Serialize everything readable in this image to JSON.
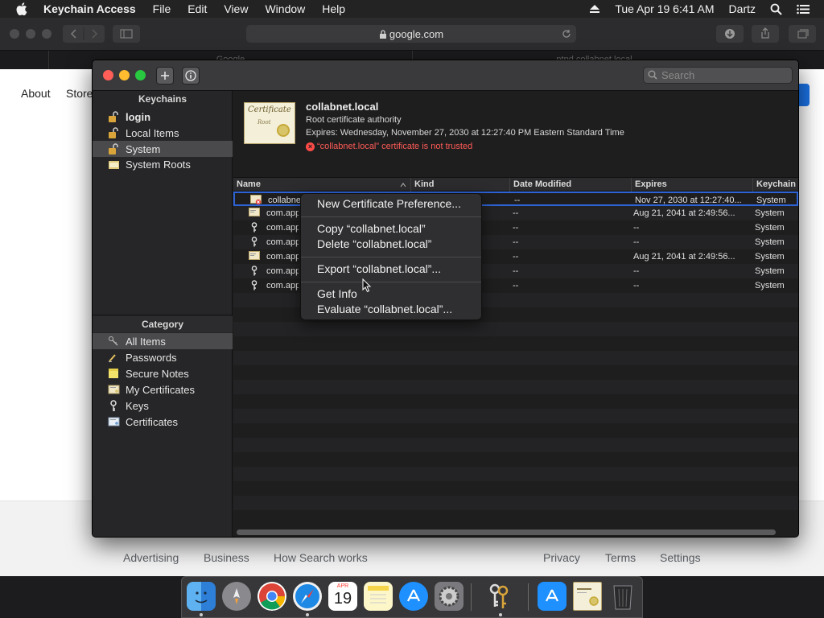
{
  "menubar": {
    "app_name": "Keychain Access",
    "menus": [
      "File",
      "Edit",
      "View",
      "Window",
      "Help"
    ],
    "datetime": "Tue Apr 19  6:41 AM",
    "user": "Dartz"
  },
  "safari": {
    "url": "google.com",
    "tabs": [
      "Google",
      "ntpd.collabnet.local"
    ]
  },
  "webpage": {
    "top_links": [
      "About",
      "Store"
    ],
    "footer_links_left": [
      "Advertising",
      "Business",
      "How Search works"
    ],
    "footer_links_right": [
      "Privacy",
      "Terms",
      "Settings"
    ]
  },
  "keychain_window": {
    "search_placeholder": "Search",
    "sidebar": {
      "keychains_header": "Keychains",
      "keychains": [
        {
          "label": "login",
          "icon": "lock-open-icon"
        },
        {
          "label": "Local Items",
          "icon": "lock-icon"
        },
        {
          "label": "System",
          "icon": "lock-icon",
          "selected": true
        },
        {
          "label": "System Roots",
          "icon": "folder-icon"
        }
      ],
      "category_header": "Category",
      "categories": [
        {
          "label": "All Items",
          "icon": "all-items-icon",
          "selected": true
        },
        {
          "label": "Passwords",
          "icon": "pencil-icon"
        },
        {
          "label": "Secure Notes",
          "icon": "note-icon"
        },
        {
          "label": "My Certificates",
          "icon": "my-certificate-icon"
        },
        {
          "label": "Keys",
          "icon": "key-icon"
        },
        {
          "label": "Certificates",
          "icon": "certificate-icon"
        }
      ]
    },
    "cert_info": {
      "icon_text": "Certificate",
      "icon_subtext": "Root",
      "name": "collabnet.local",
      "type": "Root certificate authority",
      "expires": "Expires: Wednesday, November 27, 2030 at 12:27:40 PM Eastern Standard Time",
      "warning": "“collabnet.local” certificate is not trusted"
    },
    "table": {
      "columns": [
        "Name",
        "Kind",
        "Date Modified",
        "Expires",
        "Keychain"
      ],
      "rows": [
        {
          "name": "collabnet.local",
          "icon": "certificate-untrusted-icon",
          "kind": "",
          "modified": "--",
          "expires": "Nov 27, 2030 at 12:27:40...",
          "keychain": "System",
          "selected": true
        },
        {
          "name": "com.apple.",
          "icon": "certificate-icon",
          "kind": "",
          "modified": "--",
          "expires": "Aug 21, 2041 at 2:49:56...",
          "keychain": "System"
        },
        {
          "name": "com.apple.",
          "icon": "key-icon",
          "kind": "",
          "modified": "--",
          "expires": "--",
          "keychain": "System"
        },
        {
          "name": "com.apple.",
          "icon": "key-icon",
          "kind": "",
          "modified": "--",
          "expires": "--",
          "keychain": "System"
        },
        {
          "name": "com.apple.",
          "icon": "certificate-icon",
          "kind": "",
          "modified": "--",
          "expires": "Aug 21, 2041 at 2:49:56...",
          "keychain": "System"
        },
        {
          "name": "com.apple.",
          "icon": "key-icon",
          "kind": "",
          "modified": "--",
          "expires": "--",
          "keychain": "System"
        },
        {
          "name": "com.apple.",
          "icon": "key-icon",
          "kind": "",
          "modified": "--",
          "expires": "--",
          "keychain": "System"
        }
      ]
    }
  },
  "context_menu": {
    "items": [
      "New Certificate Preference...",
      "Copy “collabnet.local”",
      "Delete “collabnet.local”",
      "Export “collabnet.local”...",
      "Get Info",
      "Evaluate “collabnet.local”..."
    ]
  },
  "dock": {
    "apps": [
      "finder-icon",
      "launchpad-icon",
      "chrome-icon",
      "safari-icon",
      "calendar-icon",
      "notes-icon",
      "app-store-icon",
      "system-preferences-icon",
      "keychain-access-icon",
      "applications-folder-icon",
      "certificate-file-icon",
      "trash-icon"
    ],
    "calendar_month": "APR",
    "calendar_day": "19"
  },
  "colors": {
    "selection_blue": "#2e63d6",
    "warning_red": "#ff5b57",
    "close": "#ff5f57",
    "minimize": "#febc2e",
    "zoom": "#28c840"
  }
}
